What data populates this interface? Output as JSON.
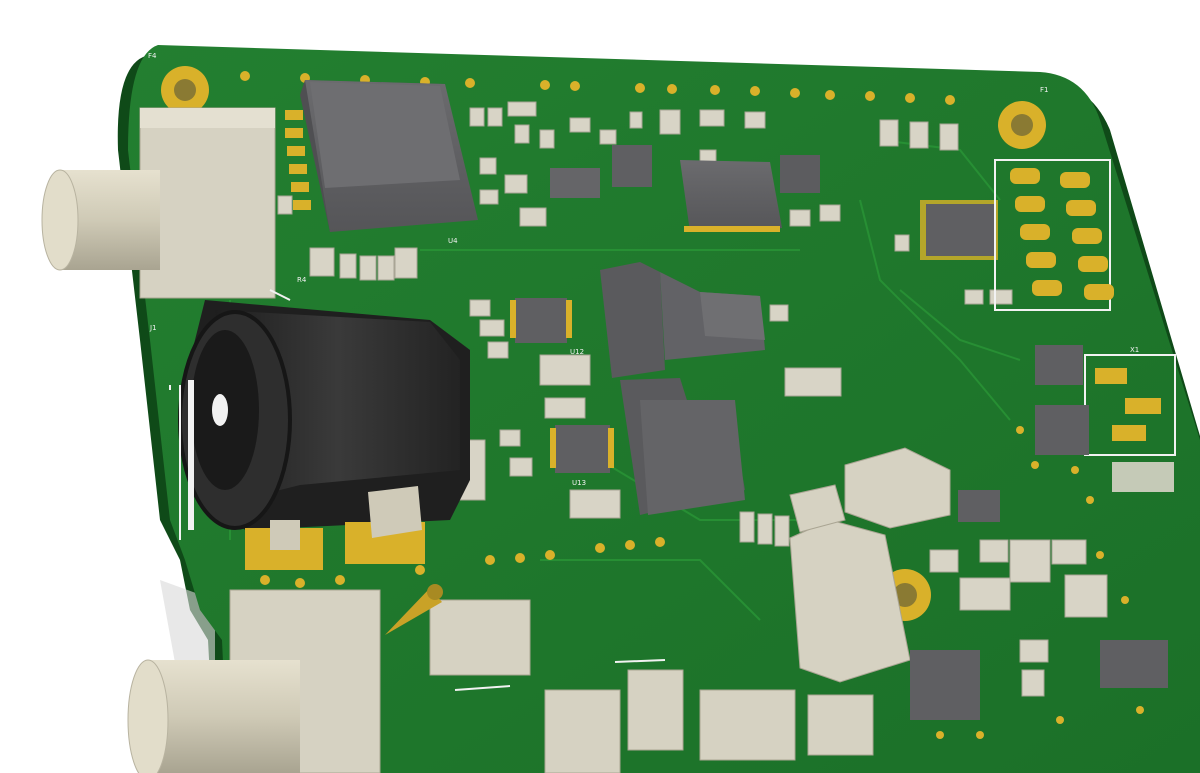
{
  "image": {
    "colors": {
      "background": "#ffffff",
      "board": "#1f7a2c",
      "board_edge": "#0f4a18",
      "copper_pour": "#23882f",
      "gold": "#d9b12a",
      "silk": "#f2f2f2",
      "ic_body": "#5f5f62",
      "cap_body": "#d8d4c6",
      "jack": "#2c2c2c",
      "connector_body": "#d6d2c2",
      "barrel": "#cfcab8"
    },
    "labels": {
      "fiducial_top_left": "F4",
      "fiducial_top_right": "F1",
      "jack_ref": "J1",
      "u4_ref": "U4",
      "r4_ref": "R4",
      "u12_ref": "U12",
      "u13_ref": "U13",
      "x1_ref": "X1"
    }
  }
}
